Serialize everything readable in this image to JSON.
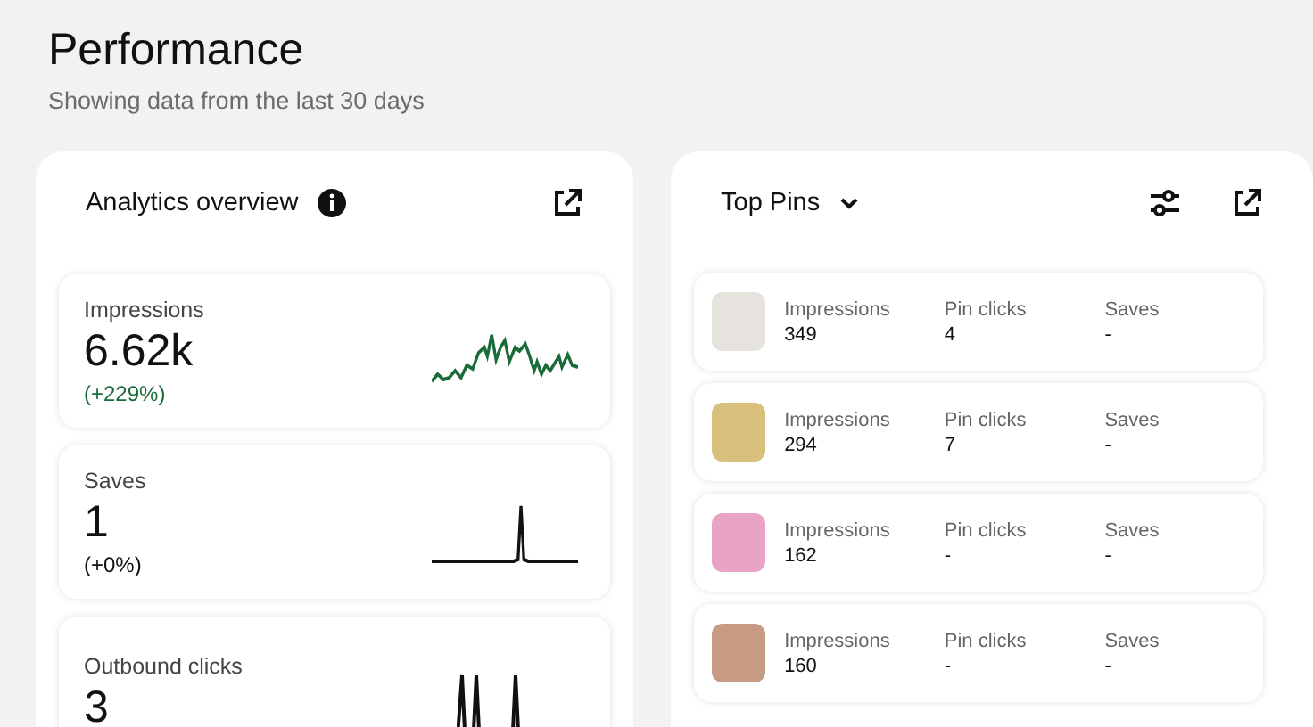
{
  "header": {
    "title": "Performance",
    "subtitle": "Showing data from the last 30 days"
  },
  "overview": {
    "title": "Analytics overview",
    "metrics": [
      {
        "label": "Impressions",
        "value": "6.62k",
        "change": "(+229%)",
        "color": "#1a6b3a"
      },
      {
        "label": "Saves",
        "value": "1",
        "change": "(+0%)",
        "color": "#111111"
      },
      {
        "label": "Outbound clicks",
        "value": "3"
      }
    ]
  },
  "top_pins": {
    "title": "Top Pins",
    "pins": [
      {
        "stats": [
          {
            "label": "Impressions",
            "value": "349"
          },
          {
            "label": "Pin clicks",
            "value": "4"
          },
          {
            "label": "Saves",
            "value": "-"
          }
        ]
      },
      {
        "stats": [
          {
            "label": "Impressions",
            "value": "294"
          },
          {
            "label": "Pin clicks",
            "value": "7"
          },
          {
            "label": "Saves",
            "value": "-"
          }
        ]
      },
      {
        "stats": [
          {
            "label": "Impressions",
            "value": "162"
          },
          {
            "label": "Pin clicks",
            "value": "-"
          },
          {
            "label": "Saves",
            "value": "-"
          }
        ]
      },
      {
        "stats": [
          {
            "label": "Impressions",
            "value": "160"
          },
          {
            "label": "Pin clicks",
            "value": "-"
          },
          {
            "label": "Saves",
            "value": "-"
          }
        ]
      }
    ]
  }
}
